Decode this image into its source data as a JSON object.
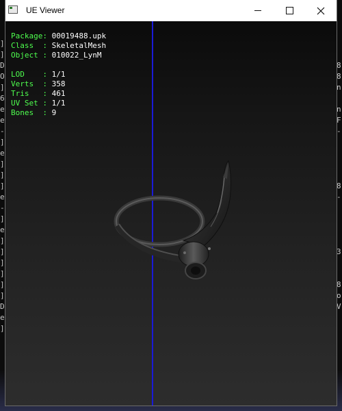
{
  "window": {
    "title": "UE Viewer",
    "minimize_label": "Minimize",
    "maximize_label": "Maximize",
    "close_label": "Close"
  },
  "info": {
    "package_label": "Package: ",
    "package_value": "00019488.upk",
    "class_label": "Class  : ",
    "class_value": "SkeletalMesh",
    "object_label": "Object : ",
    "object_value": "010022_LynM",
    "lod_label": "LOD    : ",
    "lod_value": "1/1",
    "verts_label": "Verts  : ",
    "verts_value": "358",
    "tris_label": "Tris   : ",
    "tris_value": "461",
    "uvset_label": "UV Set : ",
    "uvset_value": "1/1",
    "bones_label": "Bones  : ",
    "bones_value": "9"
  },
  "background_console": {
    "left_chars": [
      "]",
      "]",
      "D",
      "O",
      "]",
      "6",
      "e",
      "e",
      "-",
      "]",
      "e",
      "]",
      "]",
      "]",
      "e",
      "-",
      "]",
      "e",
      "]",
      "]",
      "]",
      "]",
      "]",
      "]",
      "D",
      "e",
      "]"
    ],
    "right_chars": [
      "8",
      "8",
      "n",
      "",
      "n",
      "F",
      "-",
      "",
      "",
      "",
      "",
      "8",
      "-",
      "",
      "",
      "",
      "",
      "3",
      "",
      "",
      "8",
      "o",
      "V"
    ]
  },
  "colors": {
    "info_label": "#4fff4f",
    "info_value": "#ffffff",
    "axis": "#1a1ad8"
  }
}
